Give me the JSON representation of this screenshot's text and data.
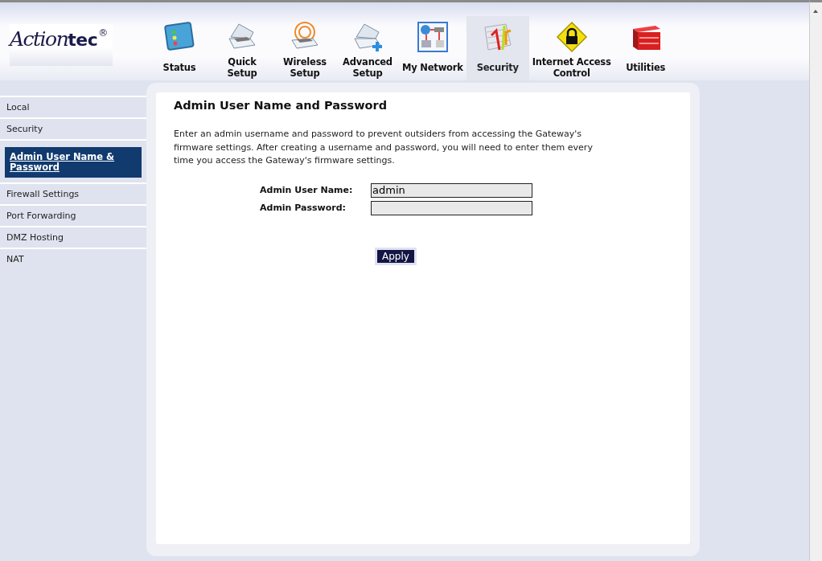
{
  "logo": {
    "script_part": "Action",
    "bold_part": "tec",
    "mark": "®"
  },
  "nav": [
    {
      "label": "Status",
      "kind": "status",
      "selected": false
    },
    {
      "label": "Quick\nSetup",
      "kind": "router",
      "selected": false
    },
    {
      "label": "Wireless\nSetup",
      "kind": "wireless",
      "selected": false
    },
    {
      "label": "Advanced\nSetup",
      "kind": "advanced",
      "selected": false
    },
    {
      "label": "My Network",
      "kind": "network",
      "selected": false
    },
    {
      "label": "Security",
      "kind": "security",
      "selected": true
    },
    {
      "label": "Internet Access\nControl",
      "kind": "lock",
      "selected": false
    },
    {
      "label": "Utilities",
      "kind": "toolbox",
      "selected": false
    }
  ],
  "sidebar": {
    "items": [
      {
        "label": "Local",
        "selected": false
      },
      {
        "label": "Security",
        "selected": false,
        "children": [
          {
            "label": "Admin User Name & Password",
            "selected": true
          }
        ]
      },
      {
        "label": "Firewall Settings",
        "selected": false
      },
      {
        "label": "Port Forwarding",
        "selected": false
      },
      {
        "label": "DMZ Hosting",
        "selected": false
      },
      {
        "label": "NAT",
        "selected": false
      }
    ]
  },
  "content": {
    "title": "Admin User Name and Password",
    "description": "Enter an admin username and password to prevent outsiders from accessing the Gateway's firmware settings. After creating a username and password, you will need to enter them every time you access the Gateway's firmware settings.",
    "fields": [
      {
        "label": "Admin User Name:",
        "value": "admin",
        "kind": "text"
      },
      {
        "label": "Admin Password:",
        "kind": "password"
      }
    ],
    "apply_button": "Apply"
  }
}
